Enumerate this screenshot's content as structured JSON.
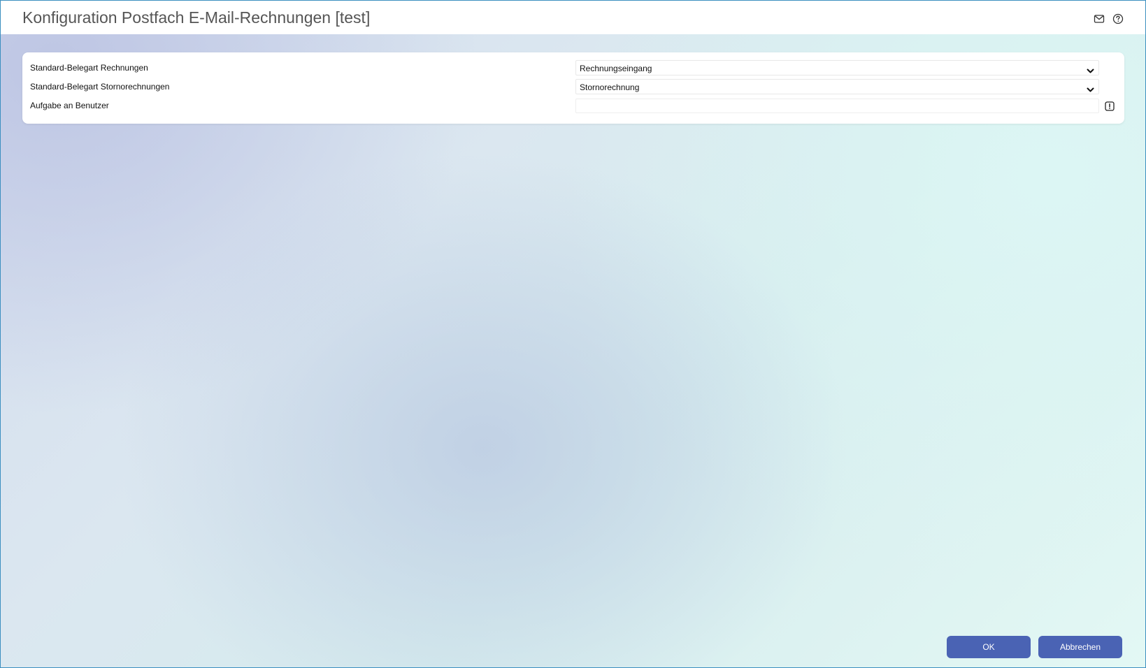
{
  "window": {
    "title": "Konfiguration Postfach E-Mail-Rechnungen [test]",
    "icons": [
      "mail-icon",
      "help-icon"
    ]
  },
  "form": {
    "rows": [
      {
        "label": "Standard-Belegart Rechnungen",
        "type": "select",
        "value": "Rechnungseingang"
      },
      {
        "label": "Standard-Belegart Stornorechnungen",
        "type": "select",
        "value": "Stornorechnung"
      },
      {
        "label": "Aufgabe an Benutzer",
        "type": "text",
        "value": "",
        "icon": "alert-icon"
      }
    ]
  },
  "footer": {
    "ok_label": "OK",
    "cancel_label": "Abbrechen"
  },
  "colors": {
    "accent": "#4a63b4",
    "window_border": "#3c8fc0",
    "title_text": "#555555"
  }
}
